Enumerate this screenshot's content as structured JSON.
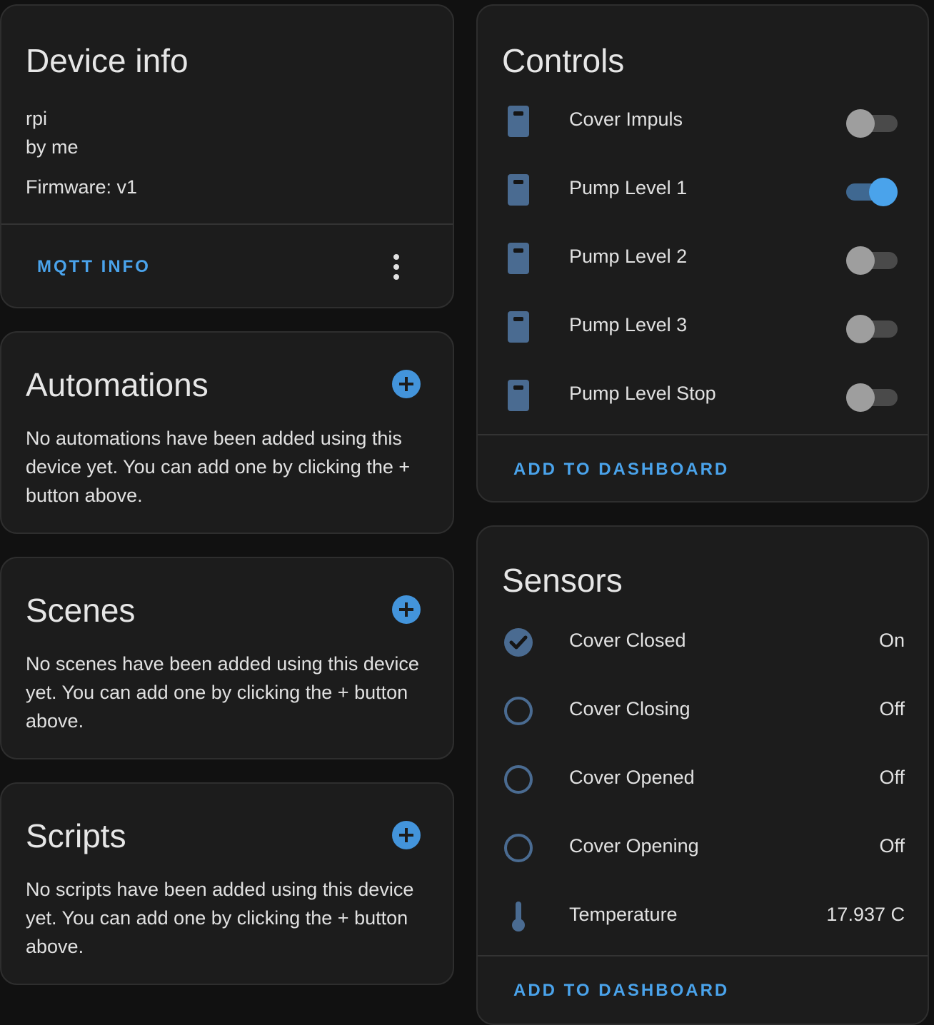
{
  "device_info": {
    "title": "Device info",
    "model": "rpi",
    "manufacturer": "by me",
    "firmware": "Firmware: v1",
    "mqtt_label": "MQTT INFO"
  },
  "automations": {
    "title": "Automations",
    "text": "No automations have been added using this device yet. You can add one by clicking the + button above."
  },
  "scenes": {
    "title": "Scenes",
    "text": "No scenes have been added using this device yet. You can add one by clicking the + button above."
  },
  "scripts": {
    "title": "Scripts",
    "text": "No scripts have been added using this device yet. You can add one by clicking the + button above."
  },
  "controls": {
    "title": "Controls",
    "items": [
      {
        "label": "Cover Impuls",
        "on": false
      },
      {
        "label": "Pump Level 1",
        "on": true
      },
      {
        "label": "Pump Level 2",
        "on": false
      },
      {
        "label": "Pump Level 3",
        "on": false
      },
      {
        "label": "Pump Level Stop",
        "on": false
      }
    ],
    "add_label": "ADD TO DASHBOARD"
  },
  "sensors": {
    "title": "Sensors",
    "items": [
      {
        "label": "Cover Closed",
        "value": "On",
        "icon": "check-circle-icon"
      },
      {
        "label": "Cover Closing",
        "value": "Off",
        "icon": "circle-outline-icon"
      },
      {
        "label": "Cover Opened",
        "value": "Off",
        "icon": "circle-outline-icon"
      },
      {
        "label": "Cover Opening",
        "value": "Off",
        "icon": "circle-outline-icon"
      },
      {
        "label": "Temperature",
        "value": "17.937 C",
        "icon": "thermometer-icon"
      }
    ],
    "add_label": "ADD TO DASHBOARD"
  },
  "colors": {
    "accent": "#4aa3eb",
    "icon": "#4a6b91",
    "background": "#111111",
    "card": "#1c1c1c"
  }
}
